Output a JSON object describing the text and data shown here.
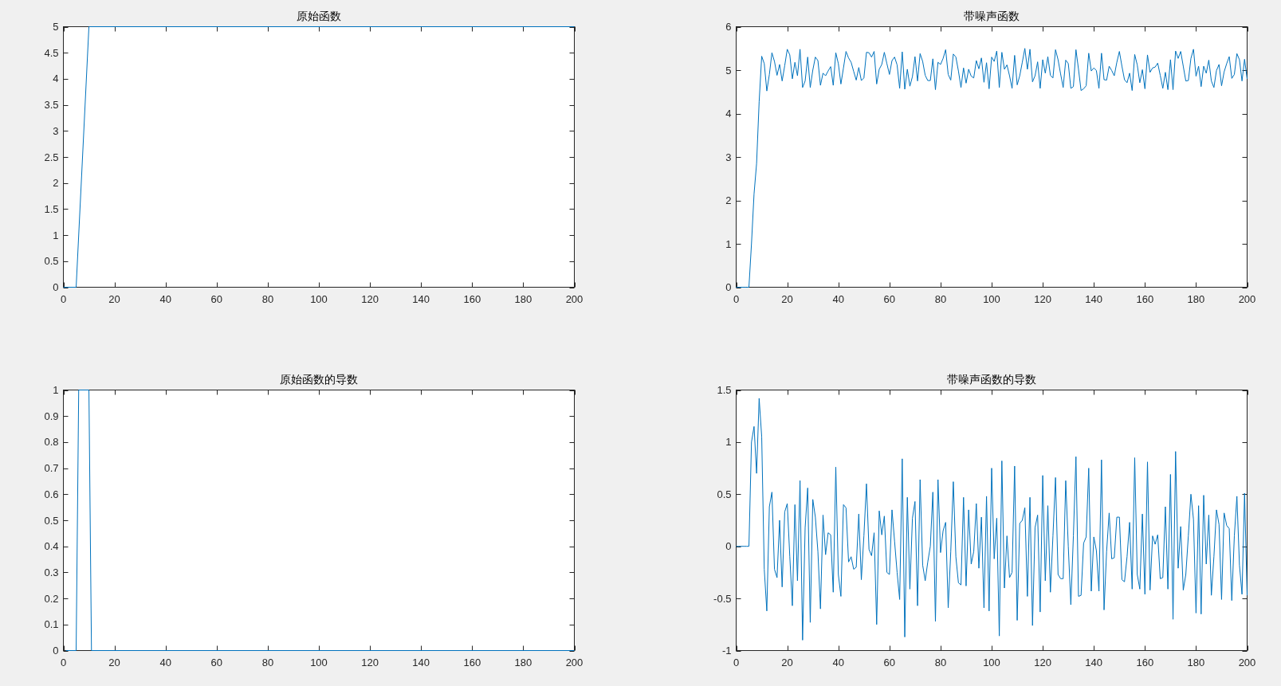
{
  "figure": {
    "subplots": [
      {
        "chart_data": {
          "type": "line",
          "title": "原始函数",
          "x": [
            0,
            5,
            10,
            200
          ],
          "series": [
            {
              "color": "#0072bd",
              "values": [
                0,
                0,
                5,
                5
              ]
            }
          ],
          "xlim": [
            0,
            200
          ],
          "ylim": [
            0,
            5
          ],
          "xticks": [
            0,
            20,
            40,
            60,
            80,
            100,
            120,
            140,
            160,
            180,
            200
          ],
          "yticks": [
            0,
            0.5,
            1,
            1.5,
            2,
            2.5,
            3,
            3.5,
            4,
            4.5,
            5
          ]
        }
      },
      {
        "chart_data": {
          "type": "line",
          "title": "带噪声函数",
          "x": [
            0,
            1,
            2,
            3,
            4,
            5,
            6,
            7,
            8,
            9,
            10,
            11,
            12,
            13,
            14,
            15,
            16,
            17,
            18,
            19,
            20,
            21,
            22,
            23,
            24,
            25,
            26,
            27,
            28,
            29,
            30,
            31,
            32,
            33,
            34,
            35,
            36,
            37,
            38,
            39,
            40,
            41,
            42,
            43,
            44,
            45,
            46,
            47,
            48,
            49,
            50,
            51,
            52,
            53,
            54,
            55,
            56,
            57,
            58,
            59,
            60,
            61,
            62,
            63,
            64,
            65,
            66,
            67,
            68,
            69,
            70,
            71,
            72,
            73,
            74,
            75,
            76,
            77,
            78,
            79,
            80,
            81,
            82,
            83,
            84,
            85,
            86,
            87,
            88,
            89,
            90,
            91,
            92,
            93,
            94,
            95,
            96,
            97,
            98,
            99,
            100,
            101,
            102,
            103,
            104,
            105,
            106,
            107,
            108,
            109,
            110,
            111,
            112,
            113,
            114,
            115,
            116,
            117,
            118,
            119,
            120,
            121,
            122,
            123,
            124,
            125,
            126,
            127,
            128,
            129,
            130,
            131,
            132,
            133,
            134,
            135,
            136,
            137,
            138,
            139,
            140,
            141,
            142,
            143,
            144,
            145,
            146,
            147,
            148,
            149,
            150,
            151,
            152,
            153,
            154,
            155,
            156,
            157,
            158,
            159,
            160,
            161,
            162,
            163,
            164,
            165,
            166,
            167,
            168,
            169,
            170,
            171,
            172,
            173,
            174,
            175,
            176,
            177,
            178,
            179,
            180,
            181,
            182,
            183,
            184,
            185,
            186,
            187,
            188,
            189,
            190,
            191,
            192,
            193,
            194,
            195,
            196,
            197,
            198,
            199,
            200
          ],
          "series": [
            {
              "color": "#0072bd",
              "values": [
                0,
                0,
                0,
                0,
                0,
                0,
                1,
                2.15,
                2.85,
                4.27,
                5.32,
                5.15,
                4.52,
                4.9,
                5.4,
                5.2,
                4.88,
                5.13,
                4.75,
                5.1,
                5.48,
                5.35,
                4.8,
                5.18,
                4.87,
                5.48,
                4.6,
                4.75,
                5.3,
                4.6,
                5,
                5.3,
                5.22,
                4.65,
                4.93,
                4.87,
                4.98,
                5.08,
                4.65,
                5.4,
                5.15,
                4.68,
                5.05,
                5.43,
                5.28,
                5.18,
                4.97,
                4.77,
                5.06,
                4.76,
                4.82,
                5.41,
                5.4,
                5.3,
                5.43,
                4.68,
                5.02,
                5.13,
                5.41,
                5.15,
                4.9,
                5.22,
                5.3,
                5.12,
                4.58,
                5.42,
                4.56,
                5.02,
                4.63,
                4.85,
                5.31,
                4.75,
                5.38,
                5.2,
                4.88,
                4.76,
                4.76,
                5.26,
                4.55,
                5.18,
                5.13,
                5.27,
                5.47,
                4.9,
                4.77,
                5.37,
                5.3,
                4.98,
                4.6,
                5.05,
                4.7,
                5.02,
                4.86,
                4.82,
                5.22,
                5.03,
                5.28,
                4.72,
                5.17,
                4.57,
                5.3,
                5.2,
                5.44,
                4.6,
                5.41,
                5.02,
                5.12,
                4.87,
                4.58,
                5.34,
                4.66,
                4.87,
                5.18,
                5.5,
                5.02,
                5.48,
                4.73,
                4.87,
                5.19,
                4.58,
                5.24,
                4.93,
                5.31,
                4.88,
                4.82,
                5.47,
                5.24,
                4.91,
                4.6,
                5.23,
                5.15,
                4.58,
                4.62,
                5.47,
                5.02,
                4.53,
                4.57,
                4.64,
                5.39,
                4.98,
                5.05,
                4.99,
                4.58,
                5.39,
                4.78,
                4.77,
                5.09,
                4.99,
                4.87,
                5.18,
                5.43,
                5.09,
                4.78,
                4.71,
                4.93,
                4.53,
                5.36,
                5.12,
                4.71,
                5.01,
                4.57,
                5.35,
                4.95,
                5.05,
                5.07,
                5.16,
                4.88,
                4.58,
                4.95,
                4.55,
                5.24,
                4.55,
                5.44,
                5.27,
                5.43,
                5.09,
                4.75,
                4.76,
                5.27,
                5.48,
                4.86,
                5.09,
                4.62,
                5.09,
                4.93,
                5.23,
                4.75,
                4.6,
                4.99,
                5.13,
                4.64,
                4.96,
                5.15,
                5.31,
                4.81,
                4.9,
                5.38,
                5.24,
                4.75,
                5.25,
                4.8
              ]
            }
          ],
          "xlim": [
            0,
            200
          ],
          "ylim": [
            0,
            6
          ],
          "xticks": [
            0,
            20,
            40,
            60,
            80,
            100,
            120,
            140,
            160,
            180,
            200
          ],
          "yticks": [
            0,
            1,
            2,
            3,
            4,
            5,
            6
          ]
        }
      },
      {
        "chart_data": {
          "type": "line",
          "title": "原始函数的导数",
          "x": [
            1,
            5,
            6,
            10,
            11,
            200
          ],
          "series": [
            {
              "color": "#0072bd",
              "values": [
                0,
                0,
                1,
                1,
                0,
                0
              ]
            }
          ],
          "xlim": [
            0,
            200
          ],
          "ylim": [
            0,
            1
          ],
          "xticks": [
            0,
            20,
            40,
            60,
            80,
            100,
            120,
            140,
            160,
            180,
            200
          ],
          "yticks": [
            0,
            0.1,
            0.2,
            0.3,
            0.4,
            0.5,
            0.6,
            0.7,
            0.8,
            0.9,
            1
          ]
        }
      },
      {
        "chart_data": {
          "type": "line",
          "title": "带噪声函数的导数",
          "x": [
            0,
            1,
            2,
            3,
            4,
            5,
            6,
            7,
            8,
            9,
            10,
            11,
            12,
            13,
            14,
            15,
            16,
            17,
            18,
            19,
            20,
            21,
            22,
            23,
            24,
            25,
            26,
            27,
            28,
            29,
            30,
            31,
            32,
            33,
            34,
            35,
            36,
            37,
            38,
            39,
            40,
            41,
            42,
            43,
            44,
            45,
            46,
            47,
            48,
            49,
            50,
            51,
            52,
            53,
            54,
            55,
            56,
            57,
            58,
            59,
            60,
            61,
            62,
            63,
            64,
            65,
            66,
            67,
            68,
            69,
            70,
            71,
            72,
            73,
            74,
            75,
            76,
            77,
            78,
            79,
            80,
            81,
            82,
            83,
            84,
            85,
            86,
            87,
            88,
            89,
            90,
            91,
            92,
            93,
            94,
            95,
            96,
            97,
            98,
            99,
            100,
            101,
            102,
            103,
            104,
            105,
            106,
            107,
            108,
            109,
            110,
            111,
            112,
            113,
            114,
            115,
            116,
            117,
            118,
            119,
            120,
            121,
            122,
            123,
            124,
            125,
            126,
            127,
            128,
            129,
            130,
            131,
            132,
            133,
            134,
            135,
            136,
            137,
            138,
            139,
            140,
            141,
            142,
            143,
            144,
            145,
            146,
            147,
            148,
            149,
            150,
            151,
            152,
            153,
            154,
            155,
            156,
            157,
            158,
            159,
            160,
            161,
            162,
            163,
            164,
            165,
            166,
            167,
            168,
            169,
            170,
            171,
            172,
            173,
            174,
            175,
            176,
            177,
            178,
            179,
            180,
            181,
            182,
            183,
            184,
            185,
            186,
            187,
            188,
            189,
            190,
            191,
            192,
            193,
            194,
            195,
            196,
            197,
            198,
            199,
            200
          ],
          "series": [
            {
              "color": "#0072bd",
              "values": [
                0,
                0,
                0,
                0,
                0,
                0,
                1,
                1.15,
                0.7,
                1.42,
                1.05,
                -0.22,
                -0.62,
                0.38,
                0.52,
                -0.22,
                -0.3,
                0.25,
                -0.39,
                0.33,
                0.41,
                -0.1,
                -0.57,
                0.4,
                -0.33,
                0.63,
                -0.9,
                0.18,
                0.56,
                -0.73,
                0.45,
                0.28,
                -0.05,
                -0.6,
                0.3,
                -0.08,
                0.13,
                0.11,
                -0.44,
                0.76,
                -0.27,
                -0.48,
                0.4,
                0.37,
                -0.15,
                -0.1,
                -0.22,
                -0.2,
                0.31,
                -0.32,
                0.1,
                0.6,
                -0.03,
                -0.09,
                0.13,
                -0.75,
                0.34,
                0.11,
                0.29,
                -0.25,
                -0.27,
                0.35,
                0.05,
                -0.25,
                -0.51,
                0.84,
                -0.87,
                0.47,
                -0.41,
                0.27,
                0.43,
                -0.57,
                0.64,
                -0.18,
                -0.33,
                -0.15,
                0,
                0.52,
                -0.72,
                0.64,
                -0.06,
                0.15,
                0.23,
                -0.59,
                -0.05,
                0.62,
                -0.1,
                -0.35,
                -0.37,
                0.47,
                -0.38,
                0.35,
                -0.17,
                -0.05,
                0.41,
                -0.21,
                0.28,
                -0.59,
                0.48,
                -0.62,
                0.75,
                -0.12,
                0.27,
                -0.86,
                0.82,
                -0.4,
                0.1,
                -0.3,
                -0.25,
                0.77,
                -0.71,
                0.22,
                0.25,
                0.37,
                -0.48,
                0.47,
                -0.76,
                0.18,
                0.3,
                -0.63,
                0.68,
                -0.33,
                0.39,
                -0.44,
                0.1,
                0.66,
                -0.27,
                -0.31,
                -0.31,
                0.63,
                0,
                -0.56,
                0.1,
                0.86,
                -0.48,
                -0.47,
                0.03,
                0.09,
                0.75,
                -0.43,
                0.09,
                -0.04,
                -0.43,
                0.83,
                -0.61,
                -0.05,
                0.32,
                -0.12,
                -0.11,
                0.28,
                0.28,
                -0.32,
                -0.34,
                -0.1,
                0.23,
                -0.41,
                0.85,
                -0.27,
                -0.41,
                0.31,
                -0.46,
                0.81,
                -0.42,
                0.1,
                0.02,
                0.11,
                -0.31,
                -0.3,
                0.38,
                -0.41,
                0.69,
                -0.7,
                0.91,
                -0.21,
                0.19,
                -0.42,
                -0.27,
                0.1,
                0.5,
                0.26,
                -0.64,
                0.39,
                -0.65,
                0.49,
                -0.17,
                0.3,
                -0.47,
                -0.1,
                0.35,
                0.21,
                -0.51,
                0.32,
                0.2,
                0.17,
                -0.52,
                0.1,
                0.48,
                -0.18,
                -0.46,
                0.51,
                -0.47
              ]
            }
          ],
          "xlim": [
            0,
            200
          ],
          "ylim": [
            -1,
            1.5
          ],
          "xticks": [
            0,
            20,
            40,
            60,
            80,
            100,
            120,
            140,
            160,
            180,
            200
          ],
          "yticks": [
            -1,
            -0.5,
            0,
            0.5,
            1,
            1.5
          ]
        }
      }
    ]
  }
}
